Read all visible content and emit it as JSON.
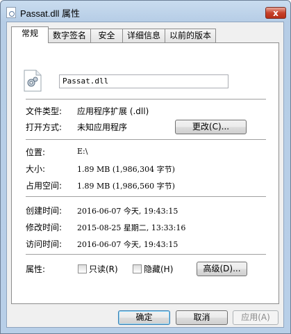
{
  "window": {
    "title": "Passat.dll 属性",
    "close_label": "x"
  },
  "tabs": [
    "常规",
    "数字签名",
    "安全",
    "详细信息",
    "以前的版本"
  ],
  "general": {
    "file_name": "Passat.dll",
    "type_label": "文件类型:",
    "type_value": "应用程序扩展 (.dll)",
    "open_with_label": "打开方式:",
    "open_with_value": "未知应用程序",
    "change_button": "更改(C)...",
    "location_label": "位置:",
    "location_value": "E:\\",
    "size_label": "大小:",
    "size_value": "1.89 MB (1,986,304 字节)",
    "size_on_disk_label": "占用空间:",
    "size_on_disk_value": "1.89 MB (1,986,560 字节)",
    "created_label": "创建时间:",
    "created_value": "2016-06-07 今天, 19:43:15",
    "modified_label": "修改时间:",
    "modified_value": "2015-08-25 星期二, 13:33:16",
    "accessed_label": "访问时间:",
    "accessed_value": "2016-06-07 今天, 19:43:15",
    "attributes_label": "属性:",
    "readonly_label": "只读(R)",
    "readonly_checked": false,
    "hidden_label": "隐藏(H)",
    "hidden_checked": false,
    "advanced_button": "高级(D)..."
  },
  "footer": {
    "ok": "确定",
    "cancel": "取消",
    "apply": "应用(A)"
  }
}
